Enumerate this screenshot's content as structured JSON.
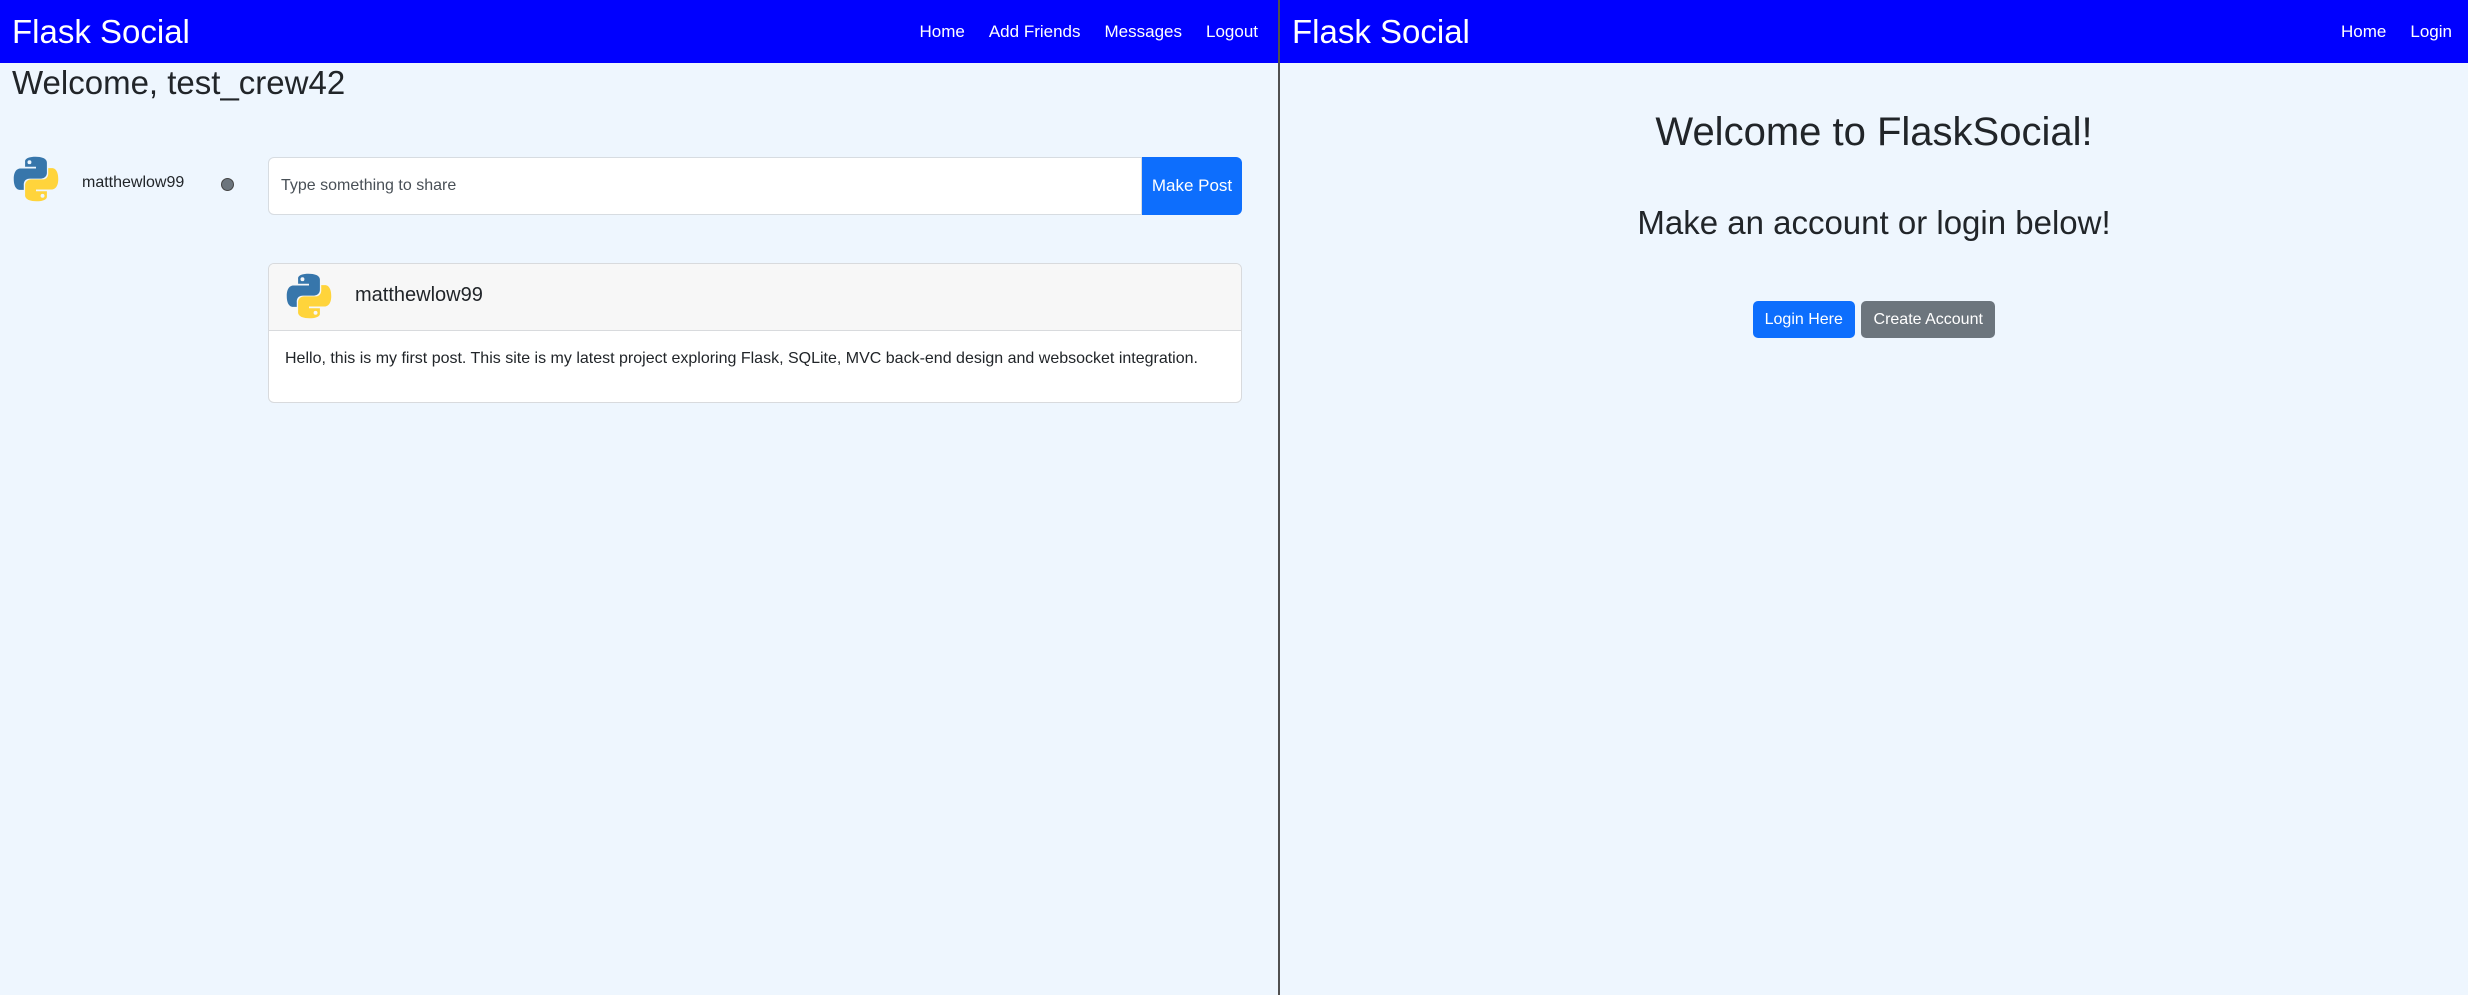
{
  "left": {
    "navbar": {
      "brand": "Flask Social",
      "links": [
        "Home",
        "Add Friends",
        "Messages",
        "Logout"
      ]
    },
    "welcome": "Welcome, test_crew42",
    "online_users": [
      {
        "username": "matthewlow99",
        "status": "offline",
        "status_color": "#6c757d"
      }
    ],
    "post_form": {
      "placeholder": "Type something to share",
      "button_label": "Make Post"
    },
    "posts": [
      {
        "author": "matthewlow99",
        "body": "Hello, this is my first post. This site is my latest project exploring Flask, SQLite, MVC back-end design and websocket integration."
      }
    ]
  },
  "right": {
    "navbar": {
      "brand": "Flask Social",
      "links": [
        "Home",
        "Login"
      ]
    },
    "title": "Welcome to FlaskSocial!",
    "subtitle": "Make an account or login below!",
    "buttons": {
      "login": "Login Here",
      "create": "Create Account"
    }
  },
  "colors": {
    "navbar": "#0000ff",
    "background": "#eef6fe",
    "primary": "#0d6efd",
    "secondary": "#6c757d"
  },
  "icons": {
    "avatar": "python-logo-icon"
  }
}
